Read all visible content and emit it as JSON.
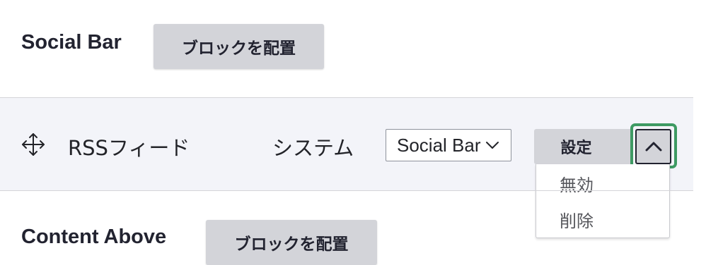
{
  "regions": [
    {
      "title": "Social Bar",
      "place_block_label": "ブロックを配置"
    },
    {
      "title": "Content Above",
      "place_block_label": "ブロックを配置"
    }
  ],
  "block_row": {
    "drag_icon": "move-arrows-icon",
    "name": "RSSフィード",
    "category": "システム",
    "region_select": {
      "selected": "Social Bar",
      "arrow_icon": "chevron-down-icon"
    },
    "operations": {
      "main_label": "設定",
      "toggle_icon": "chevron-up-icon",
      "expanded": true,
      "menu_items": [
        "無効",
        "削除"
      ]
    }
  },
  "colors": {
    "row_background": "#f3f4f9",
    "button_background": "#d3d4d9",
    "focus_ring": "#3e9a63",
    "text": "#222330"
  }
}
